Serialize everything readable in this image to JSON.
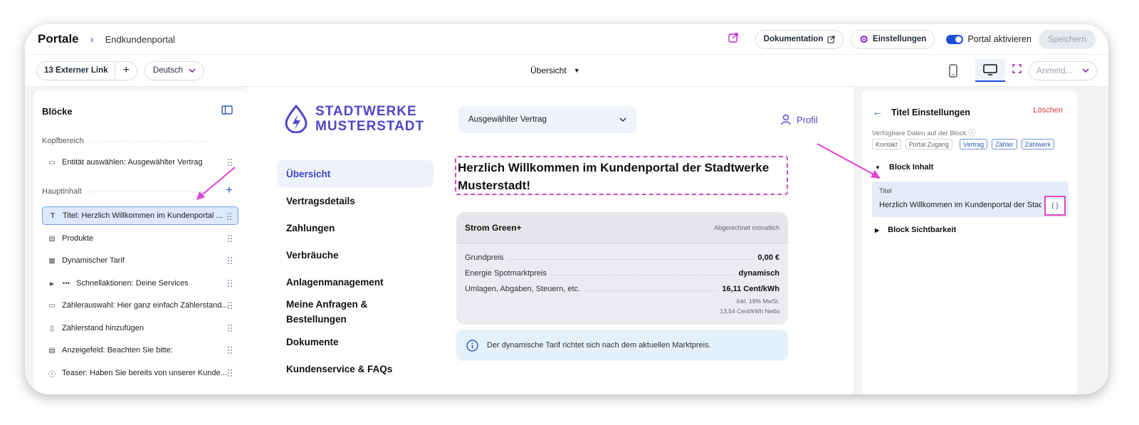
{
  "breadcrumb": {
    "root": "Portale",
    "separator": "›",
    "current": "Endkundenportal"
  },
  "topbar": {
    "documentation_label": "Dokumentation",
    "settings_label": "Einstellungen",
    "portal_toggle_label": "Portal aktivieren",
    "save_label": "Speichern"
  },
  "toolbar": {
    "external_link_label": "13 Externer Link",
    "add_label": "+",
    "language": "Deutsch",
    "view": "Übersicht",
    "login_placeholder": "Anmeld..."
  },
  "blocks": {
    "title": "Blöcke",
    "header_section": "Kopfbereich",
    "header_items": [
      {
        "label": "Entität auswählen: Ausgewählter Vertrag",
        "icon": "calendar-icon"
      }
    ],
    "main_section": "Hauptinhalt",
    "main_add": "+",
    "main_items": [
      {
        "label": "Titel: Herzlich Willkommen im Kundenportal ...",
        "icon": "T"
      },
      {
        "label": "Produkte",
        "icon": "box-icon"
      },
      {
        "label": "Dynamischer Tarif",
        "icon": "tariff-icon"
      },
      {
        "label": "Schnellaktionen: Deine Services",
        "icon": "dots-icon"
      },
      {
        "label": "Zählerauswahl: Hier ganz einfach Zählerstand...",
        "icon": "calendar-icon"
      },
      {
        "label": "Zählerstand hinzufügen",
        "icon": "doc-icon"
      },
      {
        "label": "Anzeigefeld: Beachten Sie bitte:",
        "icon": "form-icon"
      },
      {
        "label": "Teaser: Haben Sie bereits von unserer Kunde...",
        "icon": "info-icon"
      }
    ]
  },
  "preview": {
    "logo_line1": "STADTWERKE",
    "logo_line2": "MUSTERSTADT",
    "contract_select": "Ausgewählter Vertrag",
    "profile_label": "Profil",
    "nav": [
      "Übersicht",
      "Vertragsdetails",
      "Zahlungen",
      "Verbräuche",
      "Anlagenmanagement",
      "Meine Anfragen & Bestellungen",
      "Dokumente",
      "Kundenservice & FAQs"
    ],
    "welcome_title": "Herzlich Willkommen im Kundenportal der Stadtwerke Musterstadt!",
    "tariff": {
      "name": "Strom Green+",
      "billing": "Abgerechnet monatlich",
      "rows": [
        {
          "label": "Grundpreis",
          "value": "0,00 €"
        },
        {
          "label": "Energie Spotmarktpreis",
          "value": "dynamisch"
        },
        {
          "label": "Umlagen, Abgaben, Steuern, etc.",
          "value": "16,11 Cent/kWh"
        }
      ],
      "note1": "inkl. 19% MwSt.",
      "note2": "13,54 Cent/kWh Netto"
    },
    "info_text": "Der dynamische Tarif richtet sich nach dem aktuellen Marktpreis."
  },
  "settings": {
    "title": "Titel Einstellungen",
    "delete_label": "Löschen",
    "available_label": "Verfügbare Daten auf der Block",
    "chips": [
      "Kontakt",
      "Portal Zugang",
      "Vertrag",
      "Zähler",
      "Zählwerk"
    ],
    "content_section": "Block Inhalt",
    "field_label": "Titel",
    "field_value": "Herzlich Willkommen im Kundenportal der Stadtwerke Musterstadt!",
    "var_button": "{ }",
    "visibility_section": "Block Sichtbarkeit"
  },
  "colors": {
    "accent": "#4f46c9",
    "annotation": "#d946c4",
    "danger": "#d43b3b",
    "toggle": "#1d4ed8"
  }
}
